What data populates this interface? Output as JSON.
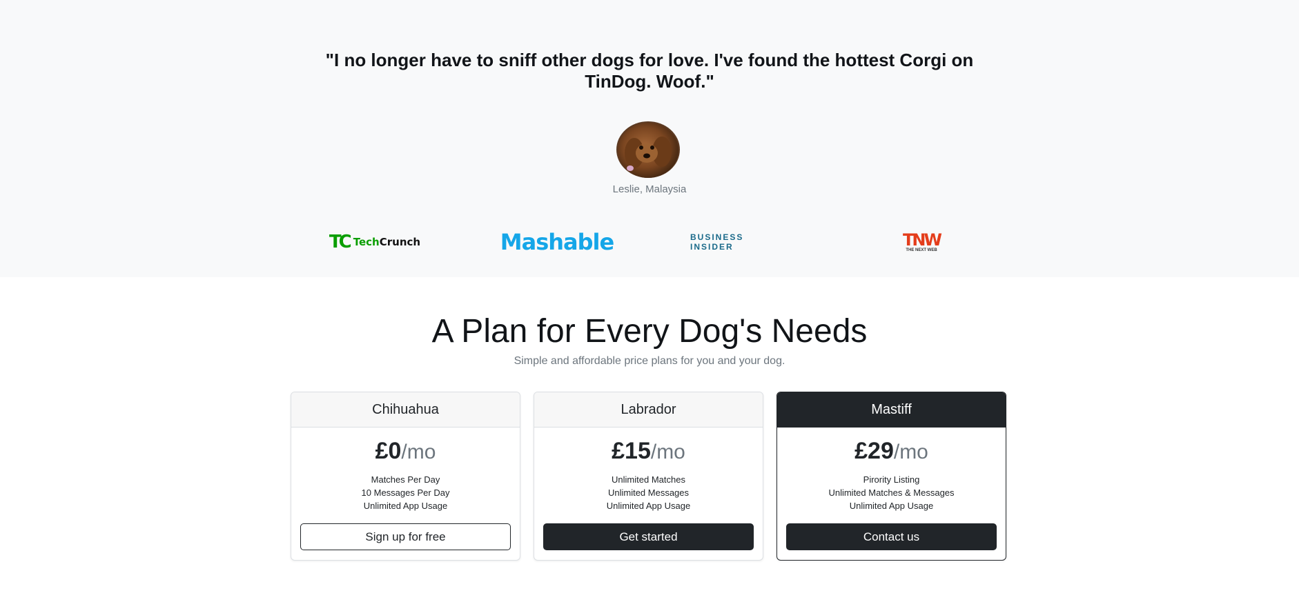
{
  "testimonial": {
    "quote": "\"I no longer have to sniff other dogs for love. I've found the hottest Corgi on TinDog. Woof.\"",
    "author": "Leslie, Malaysia"
  },
  "press": {
    "techcrunch": {
      "mark": "TC",
      "text_a": "Tech",
      "text_b": "Crunch"
    },
    "mashable": "Mashable",
    "business_insider": "BUSINESS INSIDER",
    "tnw": {
      "mark": "TNW",
      "sub": "THE NEXT WEB"
    }
  },
  "pricing": {
    "title": "A Plan for Every Dog's Needs",
    "subtitle": "Simple and affordable price plans for you and your dog.",
    "per_label": "/mo",
    "plans": [
      {
        "name": "Chihuahua",
        "price": "£0",
        "features": [
          "Matches Per Day",
          "10 Messages Per Day",
          "Unlimited App Usage"
        ],
        "button": "Sign up for free"
      },
      {
        "name": "Labrador",
        "price": "£15",
        "features": [
          "Unlimited Matches",
          "Unlimited Messages",
          "Unlimited App Usage"
        ],
        "button": "Get started"
      },
      {
        "name": "Mastiff",
        "price": "£29",
        "features": [
          "Pirority Listing",
          "Unlimited Matches & Messages",
          "Unlimited App Usage"
        ],
        "button": "Contact us"
      }
    ]
  },
  "colors": {
    "section_bg": "#f8f9fa",
    "dark": "#212529",
    "muted": "#6c757d",
    "techcrunch_green": "#0a9e01",
    "mashable_blue": "#15a6e8",
    "tnw_red": "#e43d1b"
  }
}
